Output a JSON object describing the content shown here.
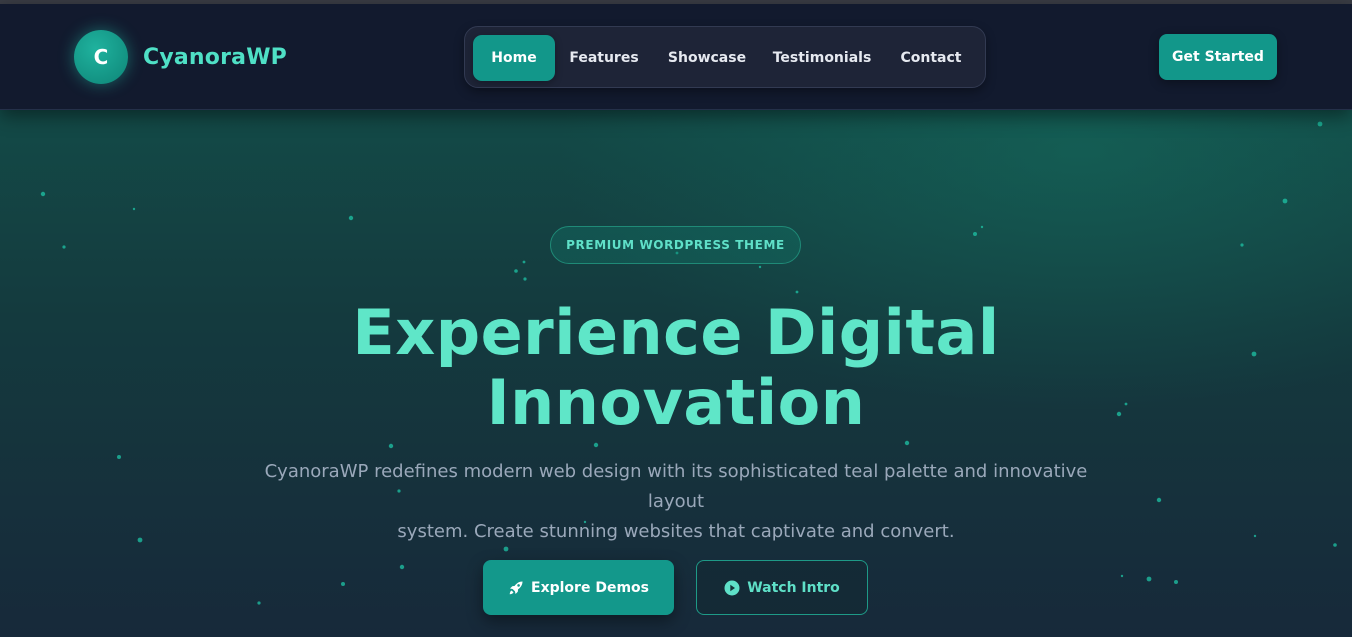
{
  "header": {
    "brand": {
      "logo_letter": "C",
      "name": "CyanoraWP"
    },
    "nav": [
      {
        "label": "Home",
        "active": true
      },
      {
        "label": "Features",
        "active": false
      },
      {
        "label": "Showcase",
        "active": false
      },
      {
        "label": "Testimonials",
        "active": false
      },
      {
        "label": "Contact",
        "active": false
      }
    ],
    "cta_label": "Get Started"
  },
  "hero": {
    "badge": "PREMIUM WORDPRESS THEME",
    "title_line1": "Experience Digital",
    "title_line2": "Innovation",
    "lead_line1": "CyanoraWP redefines modern web design with its sophisticated teal palette and innovative layout",
    "lead_line2": "system. Create stunning websites that captivate and convert.",
    "primary_button": {
      "label": "Explore Demos",
      "icon": "rocket-icon"
    },
    "secondary_button": {
      "label": "Watch Intro",
      "icon": "play-circle-icon"
    }
  },
  "colors": {
    "accent": "#12978a",
    "accent_text": "#5fe6c8",
    "header_bg": "#121a2e",
    "lead_text": "#9aa8ba"
  }
}
